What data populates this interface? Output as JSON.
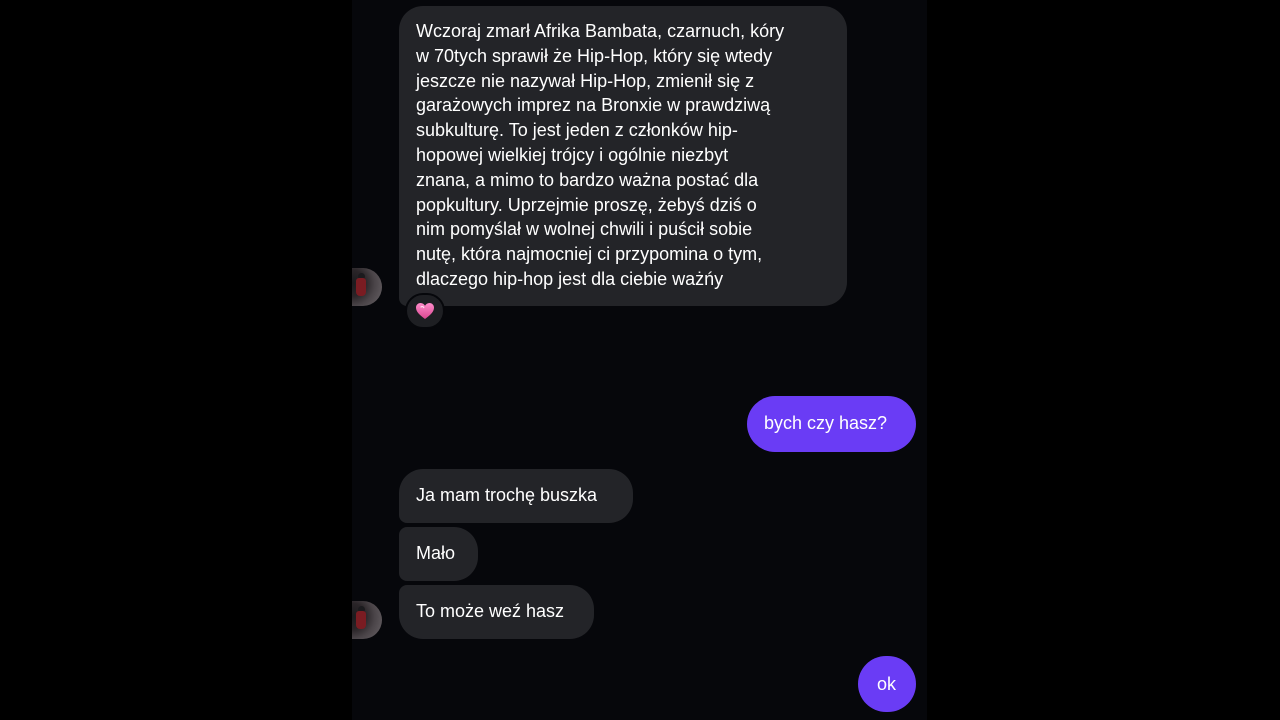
{
  "messages": {
    "long": "Wczoraj zmarł Afrika Bambata, czarnuch, kóry\nw 70tych sprawił że Hip-Hop, który się wtedy\njeszcze nie nazywał Hip-Hop, zmienił się z\ngarażowych imprez na Bronxie w prawdziwą\nsubkulturę. To jest jeden z członków hip-\nhopowej wielkiej trójcy i ogólnie niezbyt\nznana, a mimo to bardzo ważna postać dla\npopkultury. Uprzejmie proszę, żebyś  dziś o\nnim pomyślał w wolnej chwili i puścił sobie\nnutę, która najmocniej ci przypomina o tym,\ndlaczego hip-hop jest dla ciebie ważńy",
    "reaction": "heart-icon",
    "out1": "bych czy hasz?",
    "in1": "Ja mam trochę buszka",
    "in2": "Mało",
    "in3": "To może weź hasz",
    "out2": "ok"
  },
  "colors": {
    "background": "#06070b",
    "incoming_bubble": "#232428",
    "outgoing_bubble": "#6a3cf5",
    "text": "#ffffff",
    "reaction_heart": "#e75aa7"
  }
}
